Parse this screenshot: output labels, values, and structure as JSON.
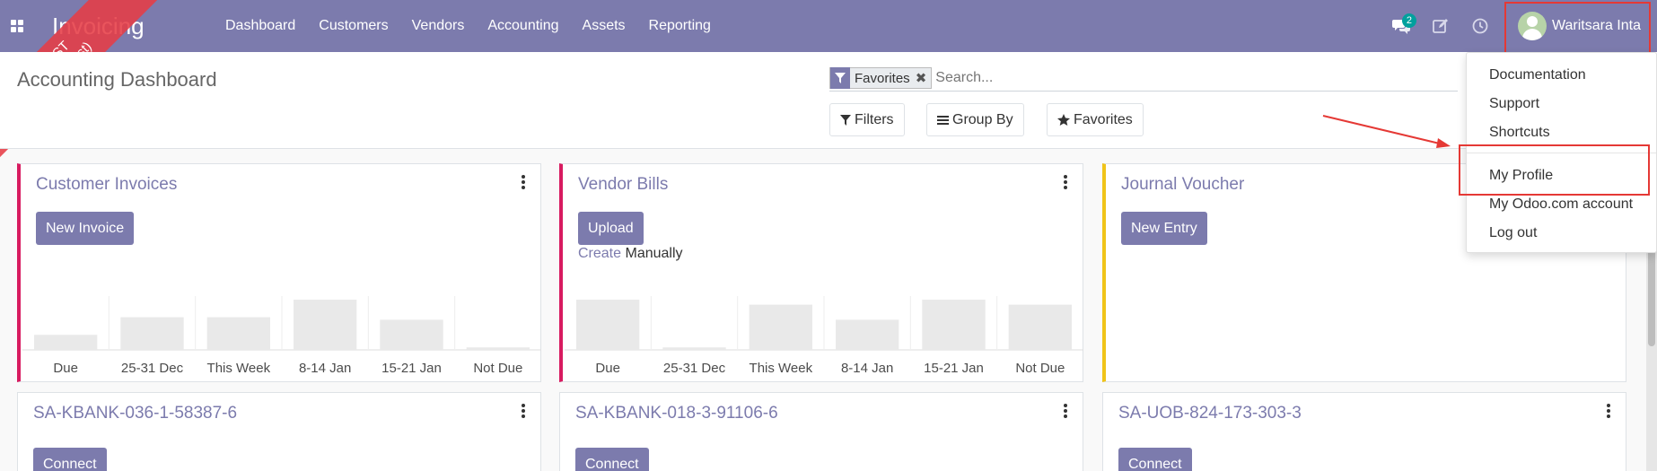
{
  "navbar": {
    "brand": "Invoicing",
    "menu": [
      "Dashboard",
      "Customers",
      "Vendors",
      "Accounting",
      "Assets",
      "Reporting"
    ],
    "messages_badge": "2",
    "user_name": "Waritsara Inta",
    "bg_color": "#7c7bad"
  },
  "ribbon": {
    "line1": "TEST",
    "line2": "(prod_test)"
  },
  "control_panel": {
    "title": "Accounting Dashboard",
    "facet": "Favorites",
    "search_placeholder": "Search...",
    "filters_label": "Filters",
    "groupby_label": "Group By",
    "favorites_label": "Favorites"
  },
  "cards": [
    {
      "title": "Customer Invoices",
      "accent": "#d81b60",
      "button": "New Invoice",
      "chart_labels": [
        "Due",
        "25-31 Dec",
        "This Week",
        "8-14 Jan",
        "15-21 Jan",
        "Not Due"
      ],
      "chart_values": [
        30,
        65,
        65,
        100,
        60,
        5
      ]
    },
    {
      "title": "Vendor Bills",
      "accent": "#d81b60",
      "button": "Upload",
      "create_link": "Create",
      "create_rest": "Manually",
      "chart_labels": [
        "Due",
        "25-31 Dec",
        "This Week",
        "8-14 Jan",
        "15-21 Jan",
        "Not Due"
      ],
      "chart_values": [
        100,
        5,
        90,
        60,
        100,
        90
      ]
    },
    {
      "title": "Journal Voucher",
      "accent": "#f0c419",
      "button": "New Entry"
    },
    {
      "title": "SA-KBANK-036-1-58387-6",
      "button": "Connect"
    },
    {
      "title": "SA-KBANK-018-3-91106-6",
      "button": "Connect"
    },
    {
      "title": "SA-UOB-824-173-303-3",
      "button": "Connect"
    }
  ],
  "user_menu": {
    "items": [
      "Documentation",
      "Support",
      "Shortcuts",
      "My Profile",
      "My Odoo.com account",
      "Log out"
    ]
  },
  "annotation_color": "#e53935"
}
